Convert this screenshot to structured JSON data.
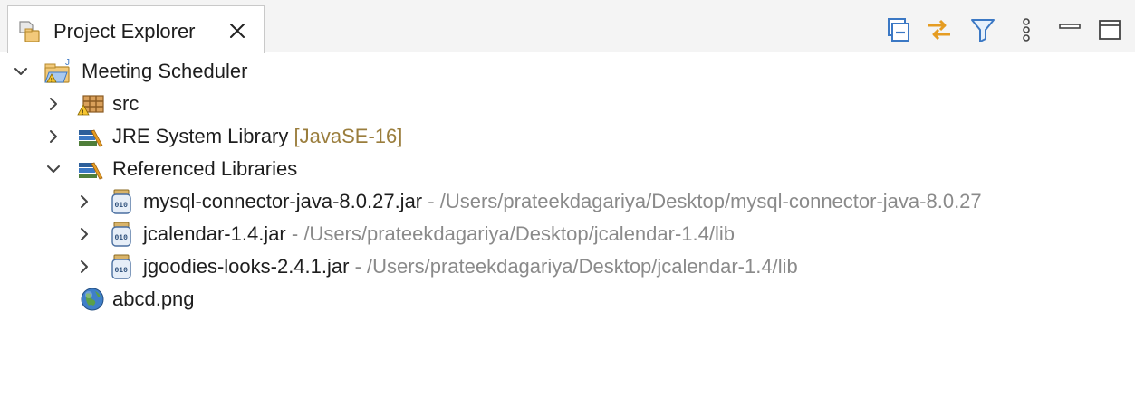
{
  "view": {
    "tab_title": "Project Explorer",
    "toolbar": {
      "collapse_all": "collapse-all-icon",
      "link_with_editor": "link-with-editor-icon",
      "filter": "filter-icon",
      "view_menu": "view-menu-icon",
      "minimize": "minimize-icon",
      "maximize": "maximize-icon"
    }
  },
  "tree": {
    "project": {
      "label": "Meeting Scheduler",
      "expanded": true
    },
    "src": {
      "label": "src"
    },
    "jre": {
      "label": "JRE System Library",
      "decoration": "[JavaSE-16]"
    },
    "ref_libs": {
      "label": "Referenced Libraries",
      "expanded": true
    },
    "jars": [
      {
        "name": "mysql-connector-java-8.0.27.jar",
        "path": "- /Users/prateekdagariya/Desktop/mysql-connector-java-8.0.27"
      },
      {
        "name": "jcalendar-1.4.jar",
        "path": "- /Users/prateekdagariya/Desktop/jcalendar-1.4/lib"
      },
      {
        "name": "jgoodies-looks-2.4.1.jar",
        "path": "- /Users/prateekdagariya/Desktop/jcalendar-1.4/lib"
      }
    ],
    "image_file": {
      "label": "abcd.png"
    }
  },
  "colors": {
    "decoration": "#9a7d3c",
    "path": "#8a8a8a",
    "accent_blue": "#3b78c4",
    "accent_orange": "#e59c22"
  }
}
